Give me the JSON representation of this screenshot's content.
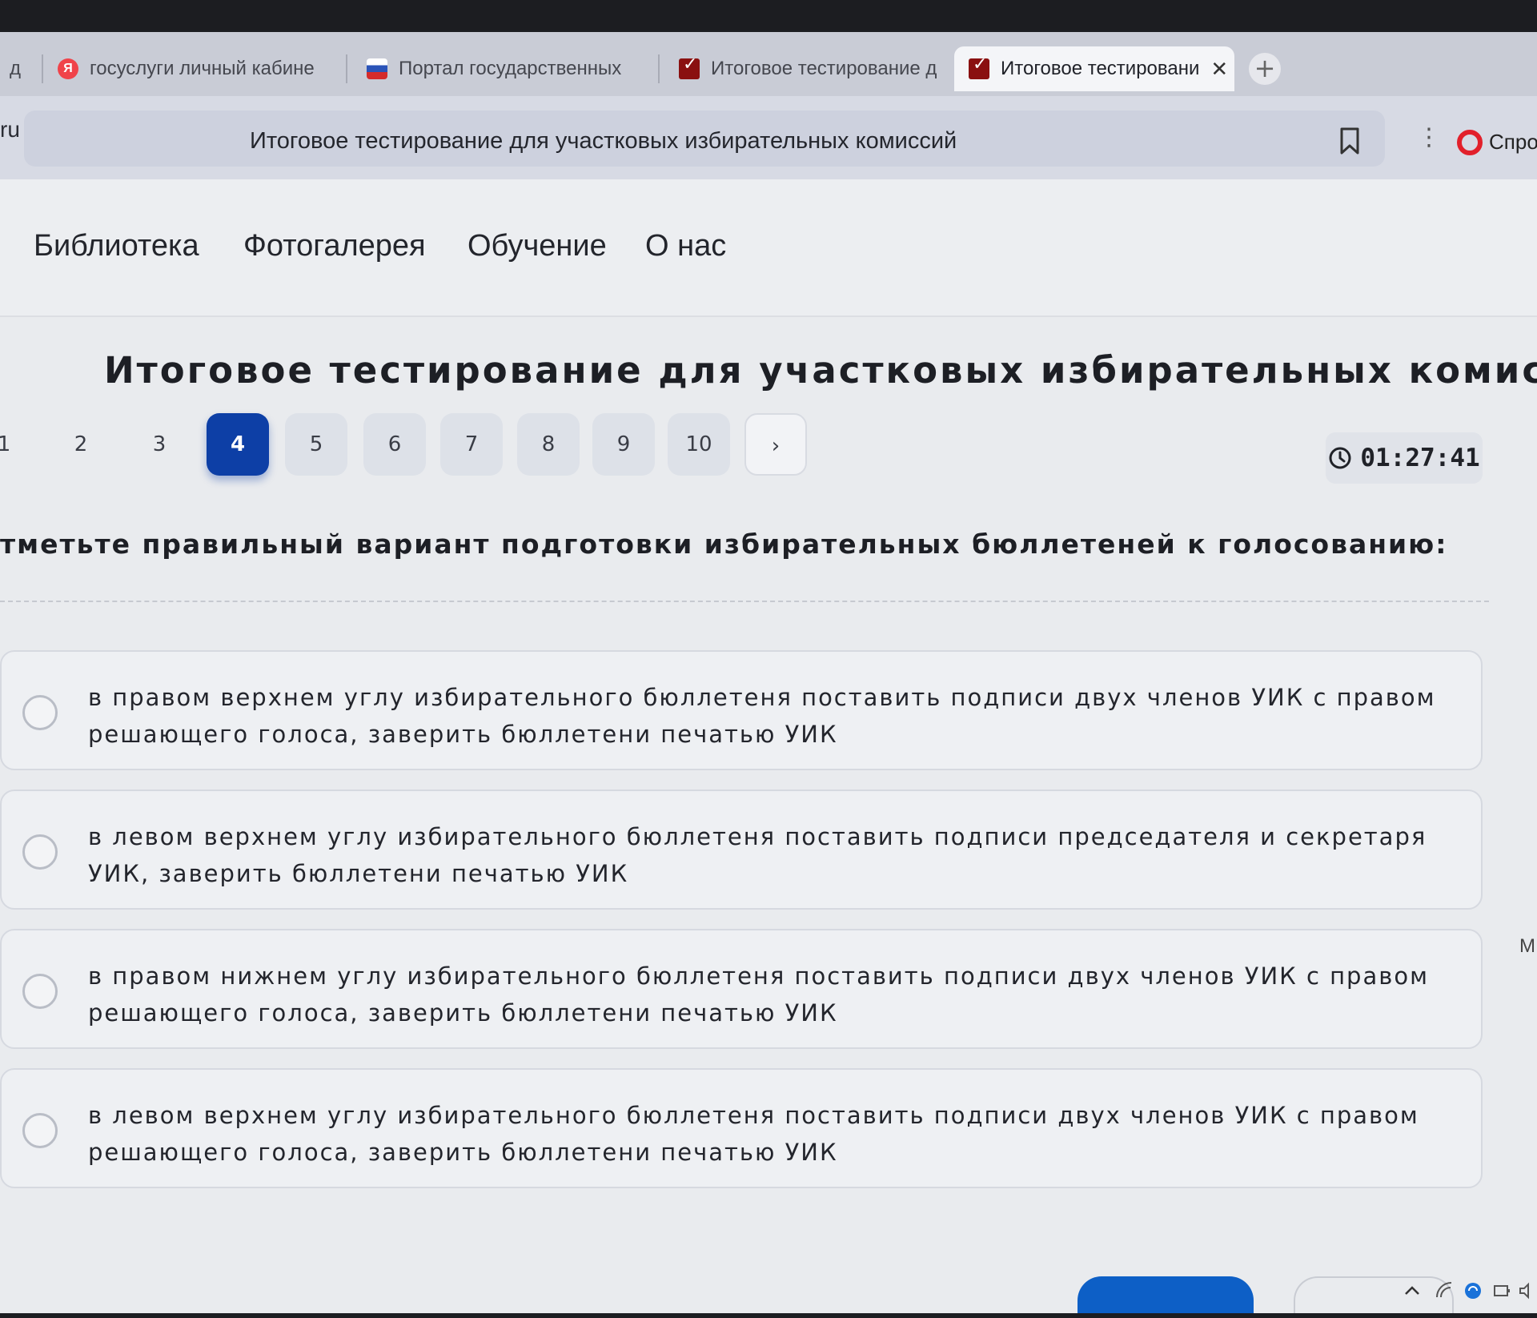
{
  "browser": {
    "tabs": [
      {
        "label": "д",
        "favicon": "generic-icon"
      },
      {
        "label": "госуслуги личный кабине",
        "favicon": "yandex-icon"
      },
      {
        "label": "Портал государственных",
        "favicon": "russia-flag-icon"
      },
      {
        "label": "Итоговое тестирование д",
        "favicon": "checkbox-icon"
      },
      {
        "label": "Итоговое тестировани",
        "favicon": "checkbox-icon",
        "active": true
      }
    ],
    "close_symbol": "✕",
    "new_tab_symbol": "+",
    "url_fragment": "ru",
    "page_title": "Итоговое тестирование для участковых избирательных комиссий",
    "more_symbol": "⋮",
    "ask_label": "Спрос"
  },
  "nav": {
    "items": [
      "Библиотека",
      "Фотогалерея",
      "Обучение",
      "О нас"
    ]
  },
  "main": {
    "title": "Итоговое тестирование для участковых избирательных комиссий",
    "question_numbers": [
      "1",
      "2",
      "3",
      "4",
      "5",
      "6",
      "7",
      "8",
      "9",
      "10"
    ],
    "current_question": 4,
    "next_symbol": "›",
    "timer": "01:27:41",
    "question": "тметьте правильный вариант подготовки избирательных бюллетеней к голосованию:",
    "options": [
      "в правом верхнем углу избирательного бюллетеня поставить подписи двух членов УИК с правом решающего голоса, заверить бюллетени печатью УИК",
      "в левом верхнем углу избирательного бюллетеня поставить подписи председателя и секретаря УИК, заверить бюллетени печатью УИК",
      "в правом нижнем углу избирательного бюллетеня поставить подписи двух членов УИК с правом решающего голоса, заверить бюллетени печатью УИК",
      "в левом верхнем углу избирательного бюллетеня поставить подписи двух членов УИК с правом решающего голоса, заверить бюллетени печатью УИК"
    ],
    "side_fragment": "М"
  },
  "colors": {
    "accent": "#0d3fa6",
    "button_blue": "#0d5fc6",
    "background": "#e9ebee"
  }
}
